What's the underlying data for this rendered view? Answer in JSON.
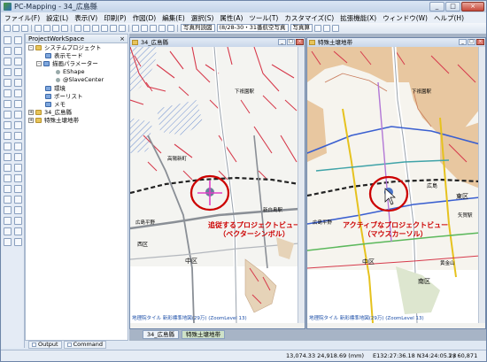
{
  "window": {
    "title": "PC-Mapping - 34_広島縣"
  },
  "window_controls": {
    "minimize": "_",
    "maximize": "□",
    "close": "×"
  },
  "menu": [
    "ファイル(F)",
    "設定(L)",
    "表示(V)",
    "印刷(P)",
    "作図(D)",
    "編集(E)",
    "選択(S)",
    "属性(A)",
    "ツール(T)",
    "カスタマイズ(C)",
    "拡張機能(X)",
    "ウィンドウ(W)",
    "ヘルプ(H)"
  ],
  "toolbar": {
    "photo_dropdown": "写真判読図",
    "coord_dropdown": "(8/28-30・31番航空写真",
    "photo_button": "写真算"
  },
  "project_workspace": {
    "title": "ProjectWorkSpace",
    "close": "×",
    "tree": [
      {
        "label": "システムプロジェクト",
        "level": 0,
        "toggle": "-"
      },
      {
        "label": "表示モード",
        "level": 1
      },
      {
        "label": "描画パラメーター",
        "level": 1,
        "toggle": "-"
      },
      {
        "label": "EShape",
        "level": 2
      },
      {
        "label": "@SlaveCenter",
        "level": 2
      },
      {
        "label": "環境",
        "level": 1
      },
      {
        "label": "ポーリスト",
        "level": 1
      },
      {
        "label": "メモ",
        "level": 1
      },
      {
        "label": "34_広島縣",
        "level": 0,
        "toggle": "+"
      },
      {
        "label": "特殊土壌地帯",
        "level": 0,
        "toggle": "+"
      }
    ],
    "tabs": [
      "Output",
      "Command"
    ]
  },
  "views": {
    "left": {
      "title": "34_広島縣",
      "attribution": "地理院タイル 新彩標準地図(29万) (ZoomLevel 13)",
      "annotation_line1": "追従するプロジェクトビュー",
      "annotation_line2": "（ベクターシンボル）",
      "labels": {
        "a": "下祇園駅",
        "b": "高陽新町",
        "c": "新白島駅",
        "d": "中区",
        "e": "広島平野",
        "f": "西区"
      }
    },
    "right": {
      "title": "特殊土壌地帯",
      "attribution": "地理院タイル 新彩標準地図(29万) (ZoomLevel 13)",
      "annotation_line1": "アクティブなプロジェクトビュー",
      "annotation_line2": "（マウスカーソル）",
      "labels": {
        "a": "下祇園駅",
        "b": "東区",
        "c": "矢賀駅",
        "d": "南区",
        "e": "中区",
        "f": "広島",
        "g": "黄金山",
        "h": "広島平野"
      }
    }
  },
  "view_tabs": [
    "34_広島縣",
    "特殊土壌地帯"
  ],
  "status": {
    "coords": "13,074.33  24,918.69 (mm)",
    "latlon": "E132:27:36.18 N34:24:05.28",
    "scale": "1 / 60,871"
  },
  "colors": {
    "annotation": "#cc0000",
    "left_hatch": "#6d8fd0",
    "right_soil_fill": "#e8c7a0",
    "road_red": "#d6394b"
  }
}
